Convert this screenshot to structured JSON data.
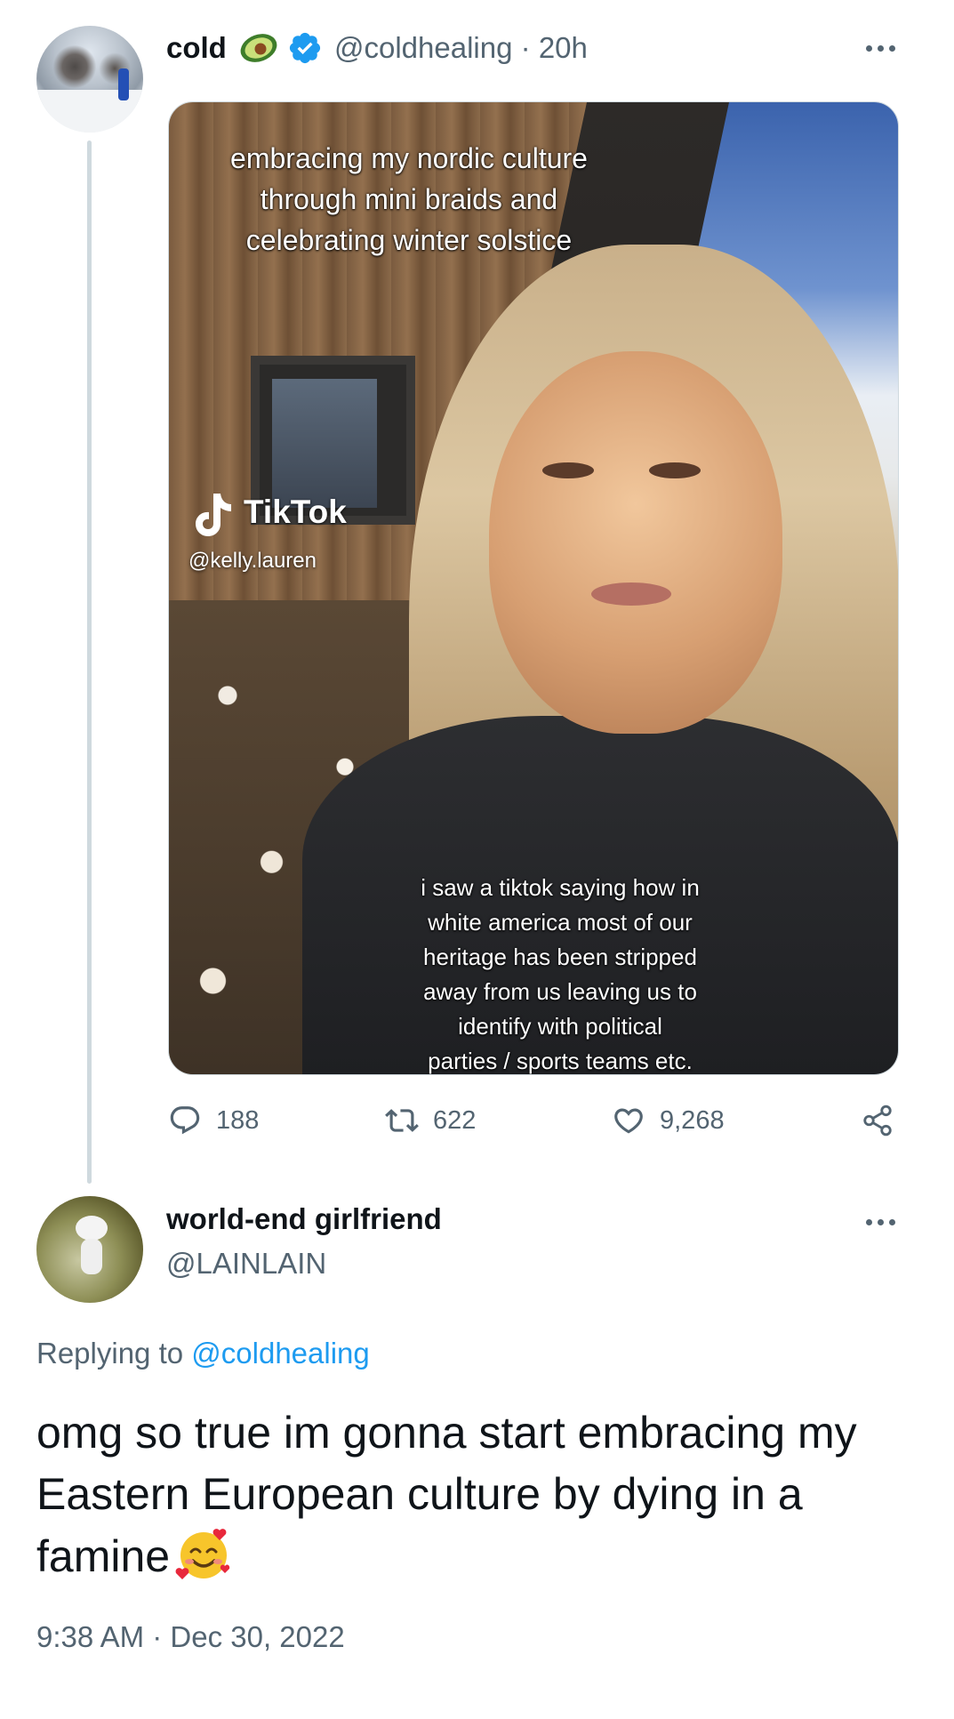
{
  "original_tweet": {
    "display_name": "cold",
    "handle": "@coldhealing",
    "separator": "·",
    "time_ago": "20h",
    "media": {
      "caption_top": "embracing my nordic culture\nthrough mini braids and\ncelebrating winter solstice",
      "caption_bottom": "i saw a tiktok saying how in\nwhite america most of our\nheritage has been stripped\naway from us leaving us to\nidentify with political\nparties / sports teams etc.",
      "watermark_name": "TikTok",
      "watermark_user": "@kelly.lauren"
    },
    "actions": {
      "replies": "188",
      "retweets": "622",
      "likes": "9,268"
    }
  },
  "reply_tweet": {
    "display_name": "world-end girlfriend",
    "handle": "@LAINLAIN",
    "replying_prefix": "Replying to",
    "replying_to": "@coldhealing",
    "text": "omg so true im gonna start embracing my Eastern European culture by dying in a famine",
    "emoji": "smiling-face-with-hearts",
    "timestamp": "9:38 AM · Dec 30, 2022"
  },
  "colors": {
    "text_primary": "#0f1419",
    "text_secondary": "#536471",
    "link": "#1d9bf0",
    "verified": "#1d9bf0",
    "thread_line": "#cfd9de"
  }
}
